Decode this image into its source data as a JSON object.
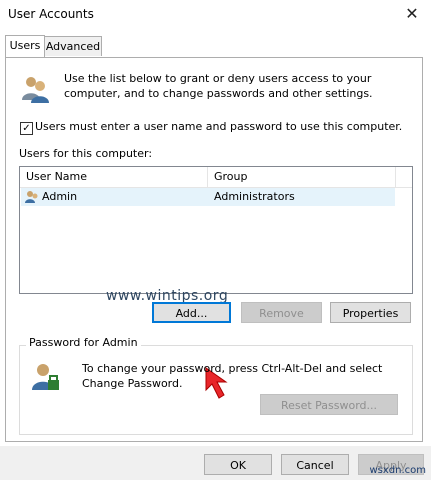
{
  "window": {
    "title": "User Accounts",
    "close_glyph": "✕"
  },
  "tabs": [
    {
      "label": "Users",
      "active": true
    },
    {
      "label": "Advanced",
      "active": false
    }
  ],
  "intro": {
    "icon": "users-group-icon",
    "text": "Use the list below to grant or deny users access to your computer, and to change passwords and other settings."
  },
  "require_login": {
    "checked": true,
    "label": "Users must enter a user name and password to use this computer."
  },
  "users_list": {
    "label": "Users for this computer:",
    "columns": [
      "User Name",
      "Group"
    ],
    "rows": [
      {
        "user": "Admin",
        "group": "Administrators"
      }
    ]
  },
  "watermark": "www.wintips.org",
  "buttons": {
    "add": "Add...",
    "remove": "Remove",
    "properties": "Properties"
  },
  "password_group": {
    "title": "Password for Admin",
    "text": "To change your password, press Ctrl-Alt-Del and select Change Password.",
    "reset_button": "Reset Password..."
  },
  "footer": {
    "ok": "OK",
    "cancel": "Cancel",
    "apply": "Apply"
  },
  "corner_watermark": "wsxdn.com",
  "colors": {
    "accent": "#0078d7",
    "selection": "#e5f3fb",
    "arrow": "#e8262a"
  }
}
